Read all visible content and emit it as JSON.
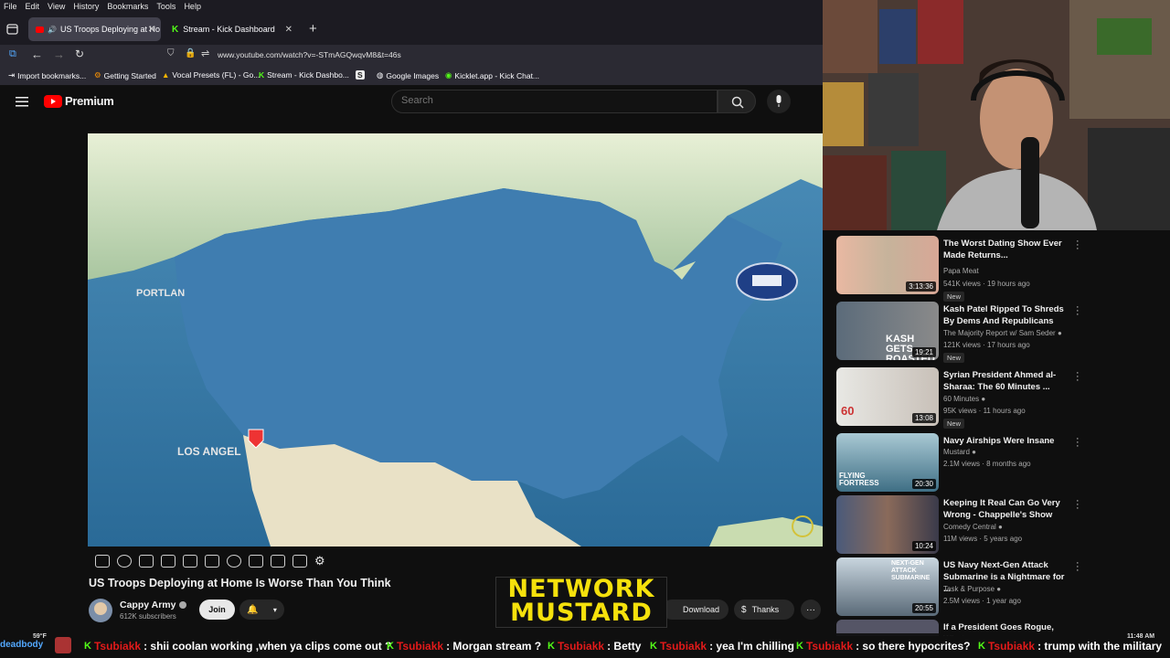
{
  "browser": {
    "menu": [
      "File",
      "Edit",
      "View",
      "History",
      "Bookmarks",
      "Tools",
      "Help"
    ],
    "tabs": [
      {
        "title": "US Troops Deploying at Ho",
        "active": true
      },
      {
        "title": "Stream - Kick Dashboard",
        "active": false
      }
    ],
    "url": "www.youtube.com/watch?v=-STmAGQwqvM8&t=46s",
    "bookmarks": [
      "Import bookmarks...",
      "Getting Started",
      "Vocal Presets (FL) - Go...",
      "Stream - Kick Dashbo...",
      "Google Images",
      "Kicklet.app - Kick Chat..."
    ]
  },
  "youtube": {
    "logo_text": "Premium",
    "search_placeholder": "Search"
  },
  "video": {
    "map_labels": {
      "portland": "PORTLAN",
      "los_angeles": "LOS ANGEL"
    },
    "title": "US Troops Deploying at Home Is Worse Than You Think",
    "channel": "Cappy Army",
    "subscribers": "612K subscribers",
    "join_label": "Join",
    "download_label": "Download",
    "thanks_label": "Thanks",
    "overlay_line1": "NETWORK",
    "overlay_line2": "MUSTARD"
  },
  "recommendations": [
    {
      "title": "The Worst Dating Show Ever Made Returns...",
      "channel": "Papa Meat",
      "verified": false,
      "meta": "541K views · 19 hours ago",
      "duration": "3:13:36",
      "new": true
    },
    {
      "title": "Kash Patel Ripped To Shreds By Dems And Republicans",
      "channel": "The Majority Report w/ Sam Seder",
      "verified": true,
      "meta": "121K views · 17 hours ago",
      "duration": "19:21",
      "new": true,
      "thumb_text": "KASH GETS ROASTED"
    },
    {
      "title": "Syrian President Ahmed al-Sharaa: The 60 Minutes ...",
      "channel": "60 Minutes",
      "verified": true,
      "meta": "95K views · 11 hours ago",
      "duration": "13:08",
      "new": true,
      "thumb_text": "60"
    },
    {
      "title": "Navy Airships Were Insane",
      "channel": "Mustard",
      "verified": true,
      "meta": "2.1M views · 8 months ago",
      "duration": "20:30",
      "new": false,
      "thumb_text": "FLYING FORTRESS"
    },
    {
      "title": "Keeping It Real Can Go Very Wrong - Chappelle's Show",
      "channel": "Comedy Central",
      "verified": true,
      "meta": "11M views · 5 years ago",
      "duration": "10:24",
      "new": false
    },
    {
      "title": "US Navy Next-Gen Attack Submarine is a Nightmare for ...",
      "channel": "Task & Purpose",
      "verified": true,
      "meta": "2.5M views · 1 year ago",
      "duration": "20:55",
      "new": false,
      "thumb_text": "NEXT-GEN ATTACK SUBMARINE"
    },
    {
      "title": "If a President Goes Rogue, What",
      "channel": "",
      "verified": false,
      "meta": "",
      "duration": "",
      "new": false
    }
  ],
  "chat": [
    {
      "user": "Tsubiakk",
      "text": ": shii coolan working ,when ya clips come out ?"
    },
    {
      "user": "Tsubiakk",
      "text": ": Morgan stream ?"
    },
    {
      "user": "Tsubiakk",
      "text": ": Betty"
    },
    {
      "user": "Tsubiakk",
      "text": ": yea I'm chilling"
    },
    {
      "user": "Tsubiakk",
      "text": ": so there hypocrites?"
    },
    {
      "user": "Tsubiakk",
      "text": ": trump with the military"
    }
  ],
  "taskbar": {
    "temp": "59°F",
    "time": "11:48 AM",
    "chat_partial_user": "deadbody"
  },
  "colors": {
    "yt_red": "#ff0000",
    "kick_green": "#53fc18",
    "chat_user_red": "#e31a1a",
    "overlay_yellow": "#f5e10c"
  }
}
